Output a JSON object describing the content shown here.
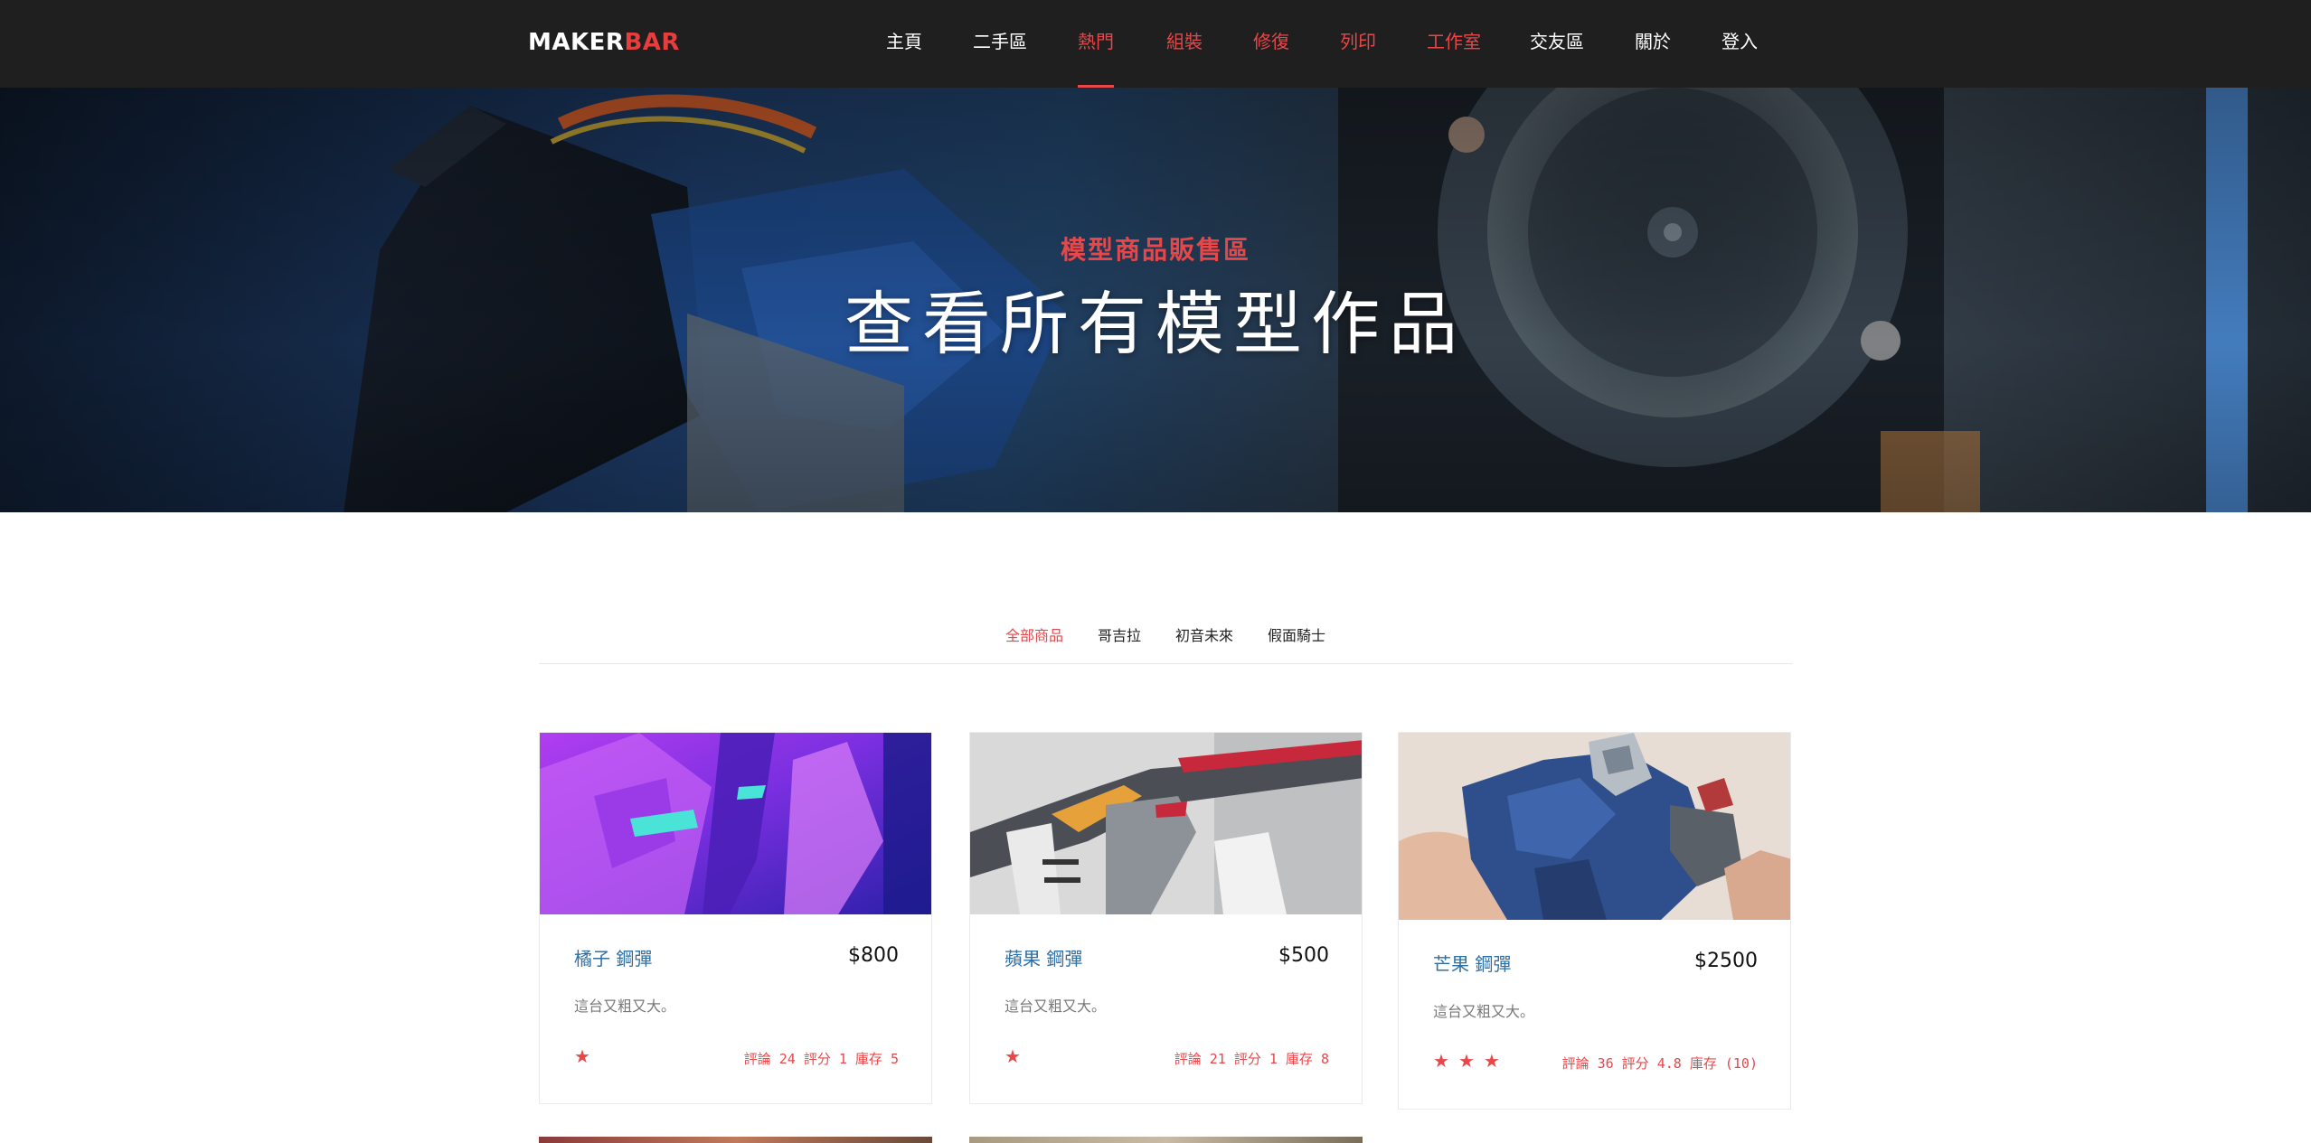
{
  "brand": {
    "part1": "MAKER",
    "part2": "BAR"
  },
  "nav": {
    "items": [
      {
        "label": "主頁"
      },
      {
        "label": "二手區"
      },
      {
        "label": "熱門"
      },
      {
        "label": "組裝"
      },
      {
        "label": "修復"
      },
      {
        "label": "列印"
      },
      {
        "label": "工作室"
      },
      {
        "label": "交友區"
      },
      {
        "label": "關於"
      },
      {
        "label": "登入"
      }
    ]
  },
  "hero": {
    "subtitle": "模型商品販售區",
    "title": "查看所有模型作品"
  },
  "filters": [
    {
      "label": "全部商品"
    },
    {
      "label": "哥吉拉"
    },
    {
      "label": "初音未來"
    },
    {
      "label": "假面騎士"
    }
  ],
  "products": [
    {
      "name": "橘子 鋼彈",
      "price": "$800",
      "desc": "這台又粗又大。",
      "stars": 1,
      "meta": "評論 24 評分 1 庫存 5"
    },
    {
      "name": "蘋果 鋼彈",
      "price": "$500",
      "desc": "這台又粗又大。",
      "stars": 1,
      "meta": "評論 21 評分 1 庫存 8"
    },
    {
      "name": "芒果 鋼彈",
      "price": "$2500",
      "desc": "這台又粗又大。",
      "stars": 3,
      "meta": "評論 36 評分 4.8 庫存 (10)"
    }
  ],
  "icons": {
    "star": "star-icon"
  },
  "colors": {
    "accent": "#e8474a",
    "navbar": "#1f1f1f",
    "product_name": "#2e6fa6"
  }
}
